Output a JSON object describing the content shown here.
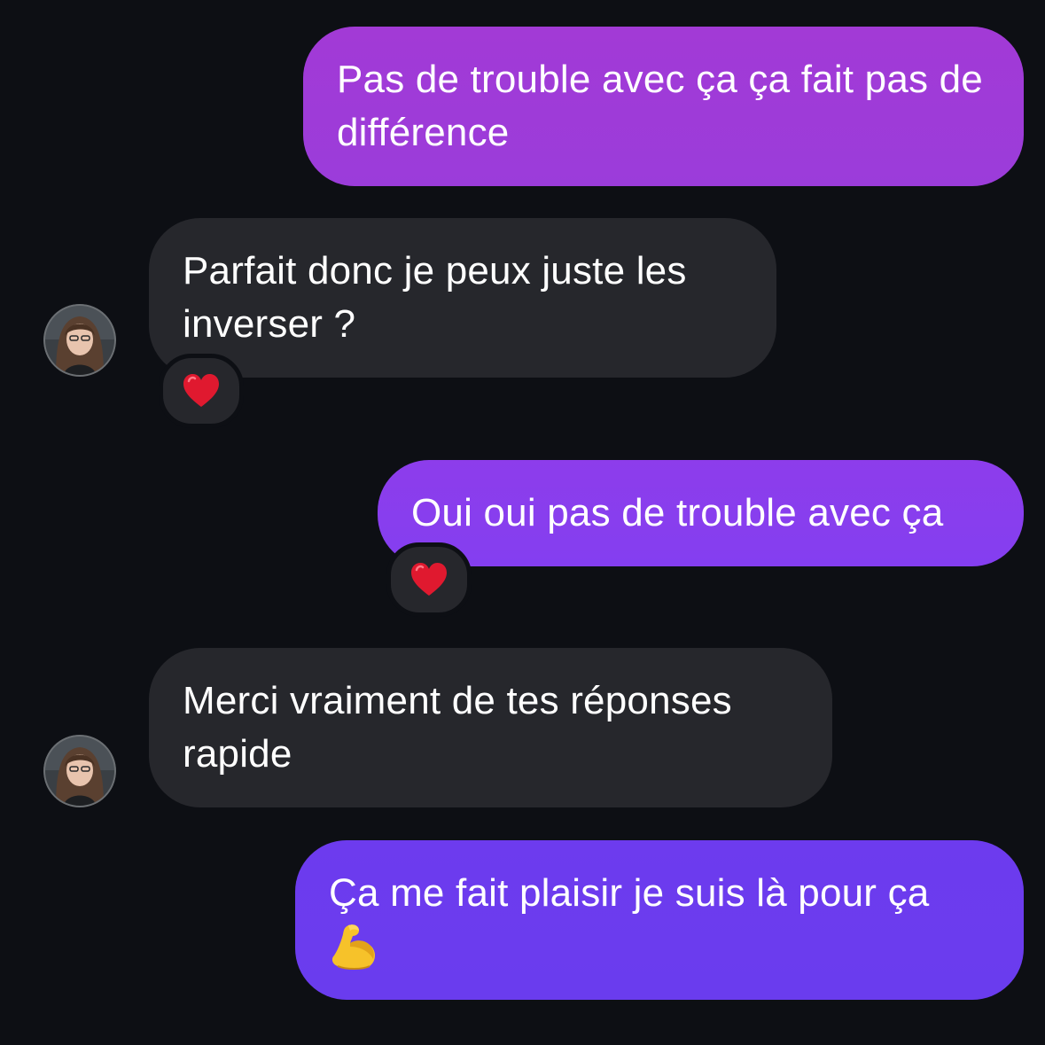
{
  "conversation": {
    "messages": [
      {
        "direction": "outgoing",
        "text": "Pas de trouble avec ça ça fait pas de différence"
      },
      {
        "direction": "incoming",
        "text": "Parfait donc je peux juste les inverser ?",
        "reaction": "heart-emoji"
      },
      {
        "direction": "outgoing",
        "text": "Oui oui pas de trouble avec ça",
        "reaction": "heart-emoji"
      },
      {
        "direction": "incoming",
        "text": "Merci vraiment de tes réponses rapide"
      },
      {
        "direction": "outgoing",
        "text": "Ça me fait plaisir je suis là pour ça",
        "trailing_icon": "flexed-biceps-emoji"
      }
    ]
  },
  "colors": {
    "background": "#0d0f14",
    "incoming_bubble": "#26272c",
    "outgoing_bubble_top": "#a23ad6",
    "outgoing_bubble_mid": "#8a3ded",
    "outgoing_bubble_bottom": "#6b3cee",
    "heart": "#e0192f",
    "biceps": "#f6c22a"
  }
}
